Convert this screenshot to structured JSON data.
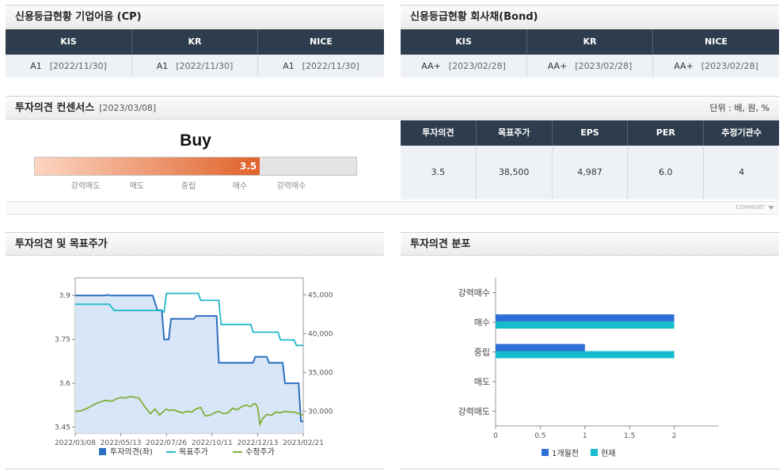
{
  "cp": {
    "title": "신용등급현황 기업어음 (CP)",
    "columns": [
      "KIS",
      "KR",
      "NICE"
    ],
    "ratings": [
      {
        "grade": "A1",
        "date": "[2022/11/30]"
      },
      {
        "grade": "A1",
        "date": "[2022/11/30]"
      },
      {
        "grade": "A1",
        "date": "[2022/11/30]"
      }
    ]
  },
  "bond": {
    "title": "신용등급현황 회사채(Bond)",
    "columns": [
      "KIS",
      "KR",
      "NICE"
    ],
    "ratings": [
      {
        "grade": "AA+",
        "date": "[2023/02/28]"
      },
      {
        "grade": "AA+",
        "date": "[2023/02/28]"
      },
      {
        "grade": "AA+",
        "date": "[2023/02/28]"
      }
    ]
  },
  "consensus": {
    "title": "투자의견 컨센서스",
    "date": "[2023/03/08]",
    "unit": "단위 : 배, 원, %",
    "opinion_label": "Buy",
    "score": "3.5",
    "score_value": 3.5,
    "scale_max": 5,
    "gauge_labels": [
      "강력매도",
      "매도",
      "중립",
      "매수",
      "강력매수"
    ],
    "table_headers": [
      "투자의견",
      "목표주가",
      "EPS",
      "PER",
      "추정기관수"
    ],
    "table_values": [
      "3.5",
      "38,500",
      "4,987",
      "6.0",
      "4"
    ],
    "comment_label": "COMMENT"
  },
  "trend": {
    "title": "투자의견 및 목표주가",
    "chart_data": {
      "type": "line",
      "x_ticks": [
        "2022/03/08",
        "2022/05/13",
        "2022/07/26",
        "2022/10/11",
        "2022/12/13",
        "2023/02/21"
      ],
      "y_left_ticks": [
        "3.9",
        "3.75",
        "3.6",
        "3.45"
      ],
      "y_left_range": [
        3.43,
        3.96
      ],
      "y_right_ticks": [
        "45,000",
        "40,000",
        "35,000",
        "30,000"
      ],
      "y_right_range": [
        27200,
        47200
      ],
      "series": [
        {
          "name": "투자의견(좌)",
          "color": "#2d6fc0",
          "axis": "left",
          "area": true,
          "points": [
            [
              0,
              3.9
            ],
            [
              13,
              3.9
            ],
            [
              14,
              3.902
            ],
            [
              15,
              3.9
            ],
            [
              34,
              3.9
            ],
            [
              36,
              3.85
            ],
            [
              38,
              3.85
            ],
            [
              39,
              3.75
            ],
            [
              41,
              3.75
            ],
            [
              42,
              3.82
            ],
            [
              52,
              3.82
            ],
            [
              53,
              3.83
            ],
            [
              62,
              3.83
            ],
            [
              63,
              3.67
            ],
            [
              78,
              3.67
            ],
            [
              79,
              3.69
            ],
            [
              84,
              3.69
            ],
            [
              85,
              3.67
            ],
            [
              91,
              3.67
            ],
            [
              92,
              3.6
            ],
            [
              98,
              3.6
            ],
            [
              99,
              3.47
            ],
            [
              100,
              3.47
            ]
          ]
        },
        {
          "name": "목표주가",
          "color": "#22b8c8",
          "axis": "right",
          "points": [
            [
              0,
              43800
            ],
            [
              15,
              43800
            ],
            [
              17,
              43000
            ],
            [
              38,
              43000
            ],
            [
              39,
              42800
            ],
            [
              40,
              45200
            ],
            [
              54,
              45200
            ],
            [
              55,
              44300
            ],
            [
              63,
              44300
            ],
            [
              64,
              41200
            ],
            [
              77,
              41200
            ],
            [
              78,
              40200
            ],
            [
              89,
              40200
            ],
            [
              90,
              39200
            ],
            [
              96,
              39200
            ],
            [
              97,
              38500
            ],
            [
              100,
              38500
            ]
          ]
        },
        {
          "name": "수정주가",
          "color": "#7fb03a",
          "axis": "right",
          "points": [
            [
              0,
              30000
            ],
            [
              3,
              30100
            ],
            [
              6,
              30500
            ],
            [
              9,
              31000
            ],
            [
              11,
              31200
            ],
            [
              13,
              31400
            ],
            [
              16,
              31300
            ],
            [
              18,
              31600
            ],
            [
              20,
              31800
            ],
            [
              22,
              31700
            ],
            [
              24,
              31900
            ],
            [
              26,
              31800
            ],
            [
              28,
              31700
            ],
            [
              30,
              30800
            ],
            [
              31,
              30400
            ],
            [
              33,
              29700
            ],
            [
              35,
              30300
            ],
            [
              37,
              29500
            ],
            [
              38,
              29800
            ],
            [
              40,
              30300
            ],
            [
              41,
              30100
            ],
            [
              43,
              30200
            ],
            [
              45,
              30000
            ],
            [
              47,
              29800
            ],
            [
              49,
              30000
            ],
            [
              51,
              29900
            ],
            [
              53,
              30300
            ],
            [
              55,
              30500
            ],
            [
              57,
              29400
            ],
            [
              59,
              29500
            ],
            [
              61,
              29800
            ],
            [
              63,
              30000
            ],
            [
              65,
              29700
            ],
            [
              67,
              29800
            ],
            [
              69,
              30400
            ],
            [
              71,
              30200
            ],
            [
              73,
              30600
            ],
            [
              75,
              30800
            ],
            [
              77,
              30600
            ],
            [
              78,
              30900
            ],
            [
              79,
              31000
            ],
            [
              80,
              30500
            ],
            [
              81,
              28300
            ],
            [
              82,
              29000
            ],
            [
              84,
              29600
            ],
            [
              86,
              29500
            ],
            [
              88,
              29900
            ],
            [
              90,
              29800
            ],
            [
              92,
              30000
            ],
            [
              94,
              29900
            ],
            [
              96,
              29900
            ],
            [
              98,
              29700
            ],
            [
              100,
              29500
            ]
          ]
        }
      ]
    }
  },
  "distribution": {
    "title": "투자의견 분포",
    "chart_data": {
      "type": "bar",
      "orientation": "horizontal",
      "categories": [
        "강력매수",
        "매수",
        "중립",
        "매도",
        "강력매도"
      ],
      "series": [
        {
          "name": "1개월전",
          "color": "#2d6fd6",
          "values": [
            0,
            2,
            1,
            0,
            0
          ]
        },
        {
          "name": "현재",
          "color": "#16bccb",
          "values": [
            0,
            2,
            2,
            0,
            0
          ]
        }
      ],
      "x_ticks": [
        "0",
        "0.5",
        "1",
        "1.5",
        "2"
      ],
      "xlim": [
        0,
        2.5
      ]
    }
  }
}
